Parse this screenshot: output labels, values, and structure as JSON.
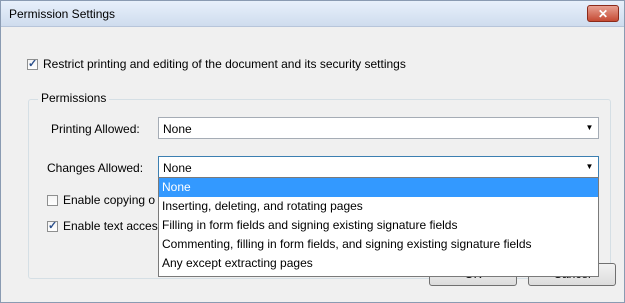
{
  "window": {
    "title": "Permission Settings",
    "close_glyph": "✕"
  },
  "restrict": {
    "checked": true,
    "label": "Restrict printing and editing of the document and its security settings"
  },
  "permissions_group": {
    "title": "Permissions"
  },
  "printing": {
    "label": "Printing Allowed:",
    "value": "None"
  },
  "changes": {
    "label": "Changes Allowed:",
    "value": "None"
  },
  "enable_copying": {
    "checked": false,
    "label": "Enable copying o"
  },
  "enable_text_access": {
    "checked": true,
    "label": "Enable text acces:"
  },
  "dropdown_options": [
    {
      "label": "None",
      "selected": true
    },
    {
      "label": "Inserting, deleting, and rotating pages",
      "selected": false
    },
    {
      "label": "Filling in form fields and signing existing signature fields",
      "selected": false
    },
    {
      "label": "Commenting, filling in form fields, and signing existing signature fields",
      "selected": false
    },
    {
      "label": "Any except extracting pages",
      "selected": false
    }
  ],
  "buttons": {
    "ok": "OK",
    "cancel": "Cancel"
  },
  "icons": {
    "checkmark": "✓",
    "dropdown_arrow": "▼"
  },
  "colors": {
    "selection": "#3399ff",
    "close_button": "#c54a33"
  }
}
